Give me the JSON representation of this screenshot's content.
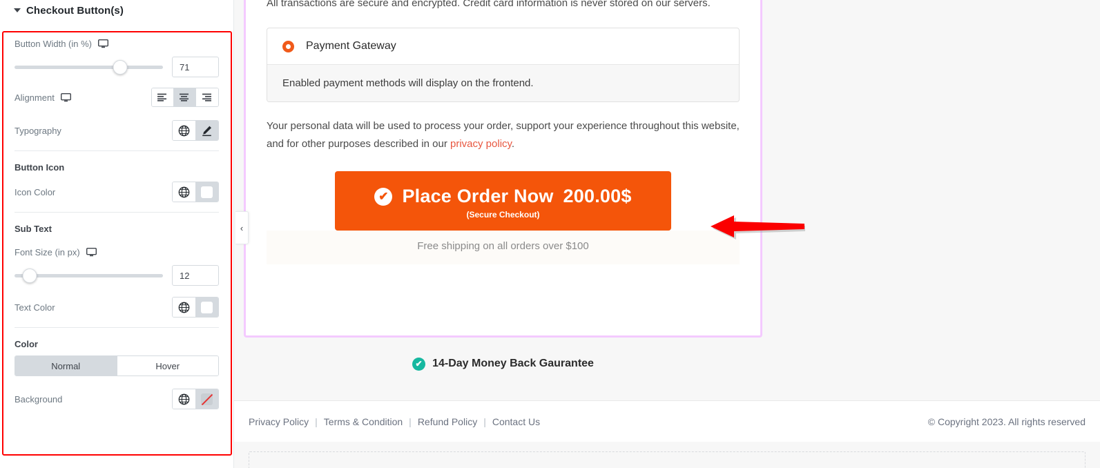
{
  "panel": {
    "section_title": "Checkout Button(s)",
    "controls": {
      "button_width_label": "Button Width (in %)",
      "button_width_value": "71",
      "button_width_percent": 71,
      "alignment_label": "Alignment",
      "alignment_options": [
        "align-left",
        "align-center",
        "align-right"
      ],
      "alignment_selected": "align-center",
      "typography_label": "Typography",
      "button_icon_heading": "Button Icon",
      "icon_color_label": "Icon Color",
      "sub_text_heading": "Sub Text",
      "font_size_label": "Font Size (in px)",
      "font_size_value": "12",
      "font_size_percent": 10,
      "text_color_label": "Text Color",
      "color_heading": "Color",
      "tab_normal": "Normal",
      "tab_hover": "Hover",
      "tab_selected": "Normal",
      "background_label": "Background"
    },
    "icons": {
      "caret": "chevron-down-icon",
      "device": "desktop-icon",
      "globe": "globe-icon",
      "pencil": "pencil-icon",
      "swatch": "color-swatch-icon",
      "no_color": "no-color-swatch-icon"
    },
    "highlight_color": "#ff0000"
  },
  "collapse_handle": {
    "glyph": "‹"
  },
  "canvas": {
    "secure_note": "All transactions are secure and encrypted. Credit card information is never stored on our servers.",
    "gateway": {
      "title": "Payment Gateway",
      "note": "Enabled payment methods will display on the frontend.",
      "radio_color": "#f05a1a"
    },
    "privacy": {
      "text_before": "Your personal data will be used to process your order, support your experience throughout this website, and for other purposes described in our ",
      "link_text": "privacy policy",
      "text_after": ".",
      "link_color": "#e8563f"
    },
    "place_order": {
      "check_glyph": "✔",
      "label": "Place Order Now",
      "amount": "200.00$",
      "sub_label": "(Secure Checkout)",
      "background_color": "#f4550a",
      "width_percent": "71%"
    },
    "free_shipping": "Free shipping on all orders over $100",
    "guarantee": {
      "check_glyph": "✔",
      "text": "14-Day Money Back Gaurantee",
      "badge_color": "#16b8a0"
    },
    "footer": {
      "links": [
        "Privacy Policy",
        "Terms & Condition",
        "Refund Policy",
        "Contact Us"
      ],
      "separator": "|",
      "copyright": "© Copyright 2023. All rights reserved"
    },
    "frame_border_color": "#f4caff"
  },
  "annotation": {
    "arrow": "left-pointing-arrow",
    "color": "#ff0000"
  }
}
